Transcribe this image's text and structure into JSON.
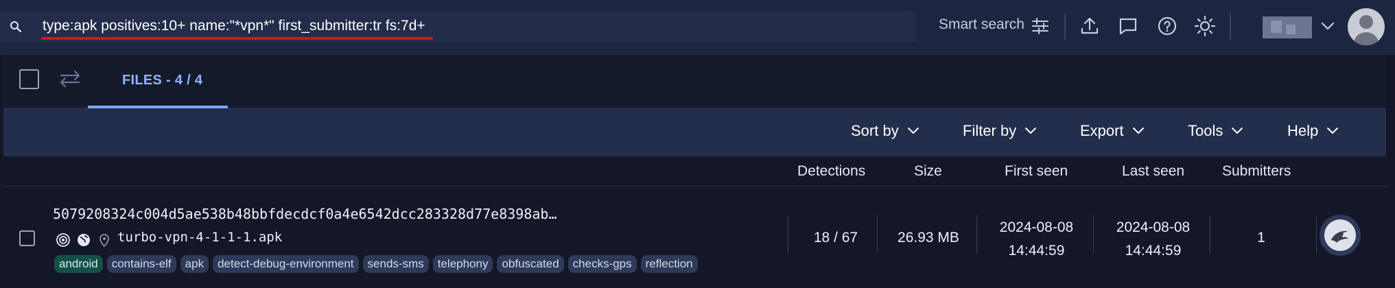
{
  "search": {
    "query": "type:apk positives:10+ name:\"*vpn*\" first_submitter:tr fs:7d+"
  },
  "topbar": {
    "smart_search_label": "Smart search",
    "icons": [
      "sliders-icon",
      "upload-icon",
      "chat-icon",
      "help-icon",
      "theme-sun-icon",
      "chevron-down-icon",
      "avatar"
    ]
  },
  "tabs": {
    "files_label": "FILES - 4 / 4"
  },
  "toolbar": {
    "sort_by": "Sort by",
    "filter_by": "Filter by",
    "export": "Export",
    "tools": "Tools",
    "help": "Help"
  },
  "columns": {
    "detections": "Detections",
    "size": "Size",
    "first_seen": "First seen",
    "last_seen": "Last seen",
    "submitters": "Submitters"
  },
  "rows": [
    {
      "hash": "5079208324c004d5ae538b48bbfdecdcf0a4e6542dcc283328d77e8398ab…",
      "file_name": "turbo-vpn-4-1-1-1.apk",
      "tags": [
        "android",
        "contains-elf",
        "apk",
        "detect-debug-environment",
        "sends-sms",
        "telephony",
        "obfuscated",
        "checks-gps",
        "reflection"
      ],
      "detections": "18 / 67",
      "size": "26.93 MB",
      "first_seen_date": "2024-08-08",
      "first_seen_time": "14:44:59",
      "last_seen_date": "2024-08-08",
      "last_seen_time": "14:44:59",
      "submitters": "1"
    }
  ],
  "colors": {
    "topbar_bg": "#1d2640",
    "page_bg": "#141728",
    "toolbar_bg": "#232e4c",
    "tab_active": "#8fb4ff",
    "underline_red": "#d8141a",
    "tag_bg": "#2f3a5a",
    "tag_android_bg": "#145048"
  }
}
